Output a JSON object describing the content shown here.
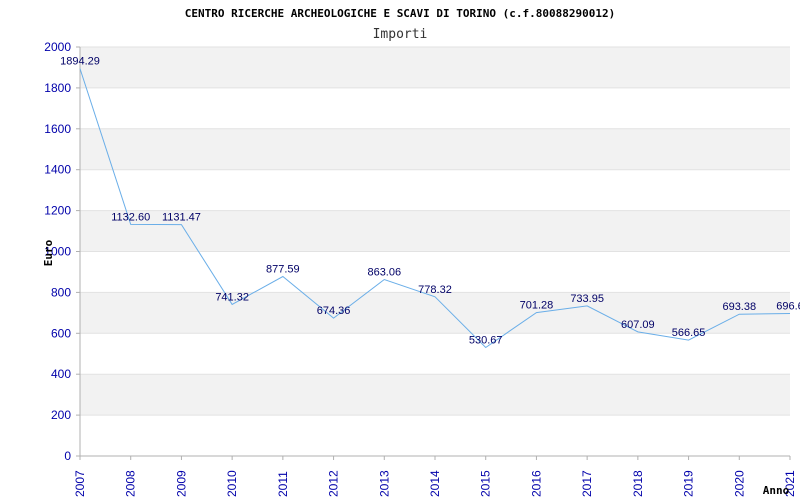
{
  "chart_data": {
    "type": "line",
    "title": "CENTRO RICERCHE ARCHEOLOGICHE E SCAVI DI TORINO (c.f.80088290012)",
    "subtitle": "Importi",
    "xlabel": "Anno",
    "ylabel": "Euro",
    "ylim": [
      0,
      2000
    ],
    "yticks": [
      0,
      200,
      400,
      600,
      800,
      1000,
      1200,
      1400,
      1600,
      1800,
      2000
    ],
    "categories": [
      "2007",
      "2008",
      "2009",
      "2010",
      "2011",
      "2012",
      "2013",
      "2014",
      "2015",
      "2016",
      "2017",
      "2018",
      "2019",
      "2020",
      "2021"
    ],
    "values": [
      1894.29,
      1132.6,
      1131.47,
      741.32,
      877.59,
      674.36,
      863.06,
      778.32,
      530.67,
      701.28,
      733.95,
      607.09,
      566.65,
      693.38,
      696.6
    ],
    "value_labels": [
      "1894.29",
      "1132.60",
      "1131.47",
      "741.32",
      "877.59",
      "674.36",
      "863.06",
      "778.32",
      "530.67",
      "701.28",
      "733.95",
      "607.09",
      "566.65",
      "693.38",
      "696.6"
    ],
    "grid": true,
    "colors": {
      "line": "#6aaee8",
      "band": "#f2f2f2",
      "axis": "#b0b0b0",
      "tick_text": "#0000aa"
    }
  }
}
